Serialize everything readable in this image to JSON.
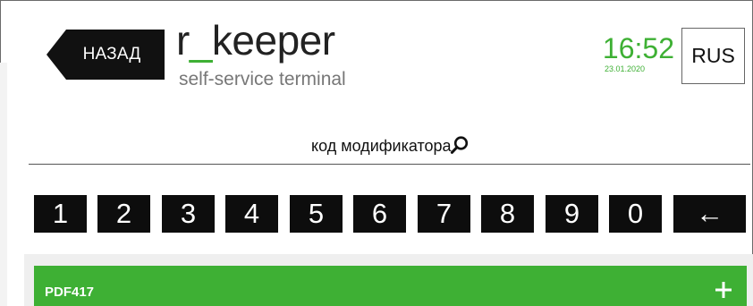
{
  "header": {
    "back_label": "НАЗАД",
    "logo_before": "r",
    "logo_underscore": "_",
    "logo_after": "keeper",
    "logo_subtitle": "self-service terminal",
    "time": "16:52",
    "date": "23.01.2020",
    "language": "RUS"
  },
  "search": {
    "label": "код модификатора",
    "icon": "search-icon"
  },
  "keypad": {
    "keys": [
      "1",
      "2",
      "3",
      "4",
      "5",
      "6",
      "7",
      "8",
      "9",
      "0",
      "←"
    ]
  },
  "modifiers": {
    "items": [
      {
        "name": "PDF417",
        "icon": "plus-icon"
      }
    ]
  },
  "colors": {
    "accent": "#3eb034",
    "key_background": "#0d0d0d",
    "panel_background": "#efefef"
  }
}
